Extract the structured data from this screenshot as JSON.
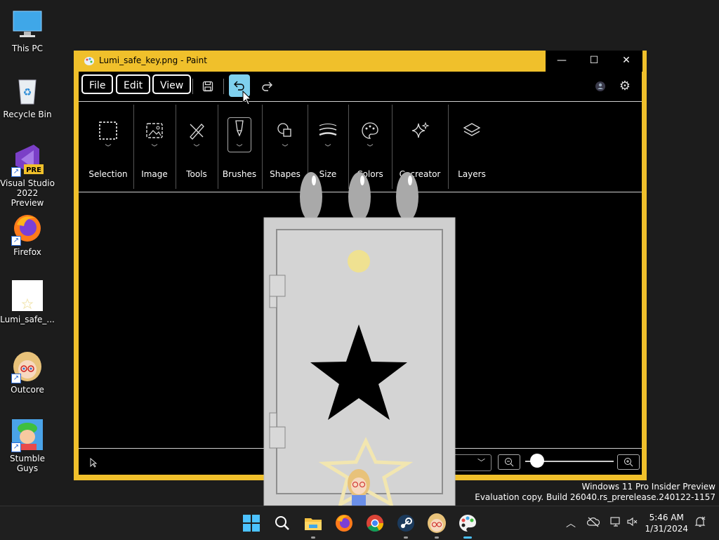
{
  "desktop": {
    "icons": [
      {
        "label": "This PC"
      },
      {
        "label": "Recycle Bin"
      },
      {
        "label": "Visual Studio 2022 Preview",
        "badge": "PRE"
      },
      {
        "label": "Firefox"
      },
      {
        "label": "Lumi_safe_..."
      },
      {
        "label": "Outcore"
      },
      {
        "label": "Stumble Guys"
      }
    ]
  },
  "window": {
    "title": "Lumi_safe_key.png - Paint",
    "controls": {
      "minimize": "—",
      "maximize": "☐",
      "close": "✕"
    },
    "menu": {
      "file": "File",
      "edit": "Edit",
      "view": "View"
    },
    "ribbon": [
      {
        "label": "Selection"
      },
      {
        "label": "Image"
      },
      {
        "label": "Tools"
      },
      {
        "label": "Brushes"
      },
      {
        "label": "Shapes"
      },
      {
        "label": "Size"
      },
      {
        "label": "Colors"
      },
      {
        "label": "Cocreator"
      },
      {
        "label": "Layers"
      }
    ]
  },
  "watermark": {
    "line1": "Windows 11 Pro Insider Preview",
    "line2": "Evaluation copy. Build 26040.rs_prerelease.240122-1157"
  },
  "taskbar": {
    "time": "5:46 AM",
    "date": "1/31/2024"
  },
  "colors": {
    "accent": "#f0c02b",
    "undo_active": "#7fd0ee",
    "safe_body": "#cfcfcf"
  }
}
